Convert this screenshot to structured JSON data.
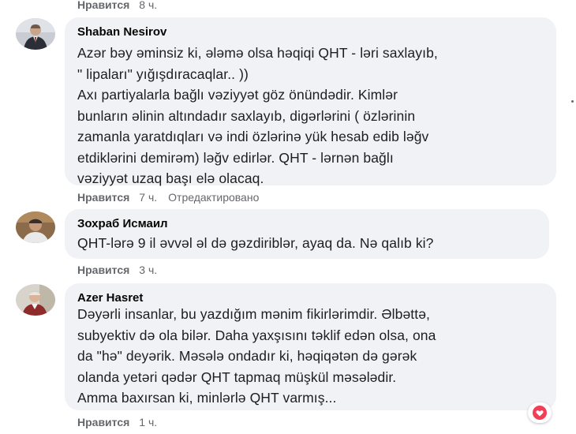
{
  "top_actions": {
    "like": "Нравится",
    "time": "8 ч."
  },
  "comments": [
    {
      "author": "Shaban Nesirov",
      "text": "Azər bəy əminsiz ki, ələmə olsa həqiqi QHT - ləri saxlayıb,\n\" lipaları\" yığışdıracaqlar.. ))\nAxı partiyalarla bağlı vəziyyət göz önündədir. Kimlər\nbunların əlinin altındadır saxlayıb, digərlərini ( özlərinin\nzamanla yaratdıqları və indi özlərinə yük hesab edib ləğv\netdiklərini demirəm) ləğv edirlər. QHT - lərnən bağlı\nvəziyyət uzaq başı elə olacaq.",
      "actions": {
        "like": "Нравится",
        "time": "7 ч.",
        "edited": "Отредактировано"
      }
    },
    {
      "author": "Зохраб Исмаил",
      "text": "QHT-lərə 9 il əvvəl əl də gəzdiriblər, ayaq da. Nə qalıb ki?",
      "actions": {
        "like": "Нравится",
        "time": "3 ч."
      }
    },
    {
      "author": "Azer Hasret",
      "text": "Dəyərli insanlar, bu yazdığım mənim fikirlərimdir. Əlbəttə,\nsubyektiv də ola bilər. Daha yaxşısını təklif edən olsa, ona\nda \"hə\" deyərik. Məsələ ondadır ki, həqiqətən də gərək\nolanda yetəri qədər QHT tapmaq müşkül məsələdir.\nAmma baxırsan ki, minlərlə QHT varmış...",
      "actions": {
        "like": "Нравится",
        "time": "1 ч."
      },
      "reaction_icon": "heart-reaction-icon"
    }
  ],
  "colors": {
    "bubble_bg": "#f0f2f5",
    "meta_text": "#65676b",
    "heart_red": "#f33e58"
  }
}
